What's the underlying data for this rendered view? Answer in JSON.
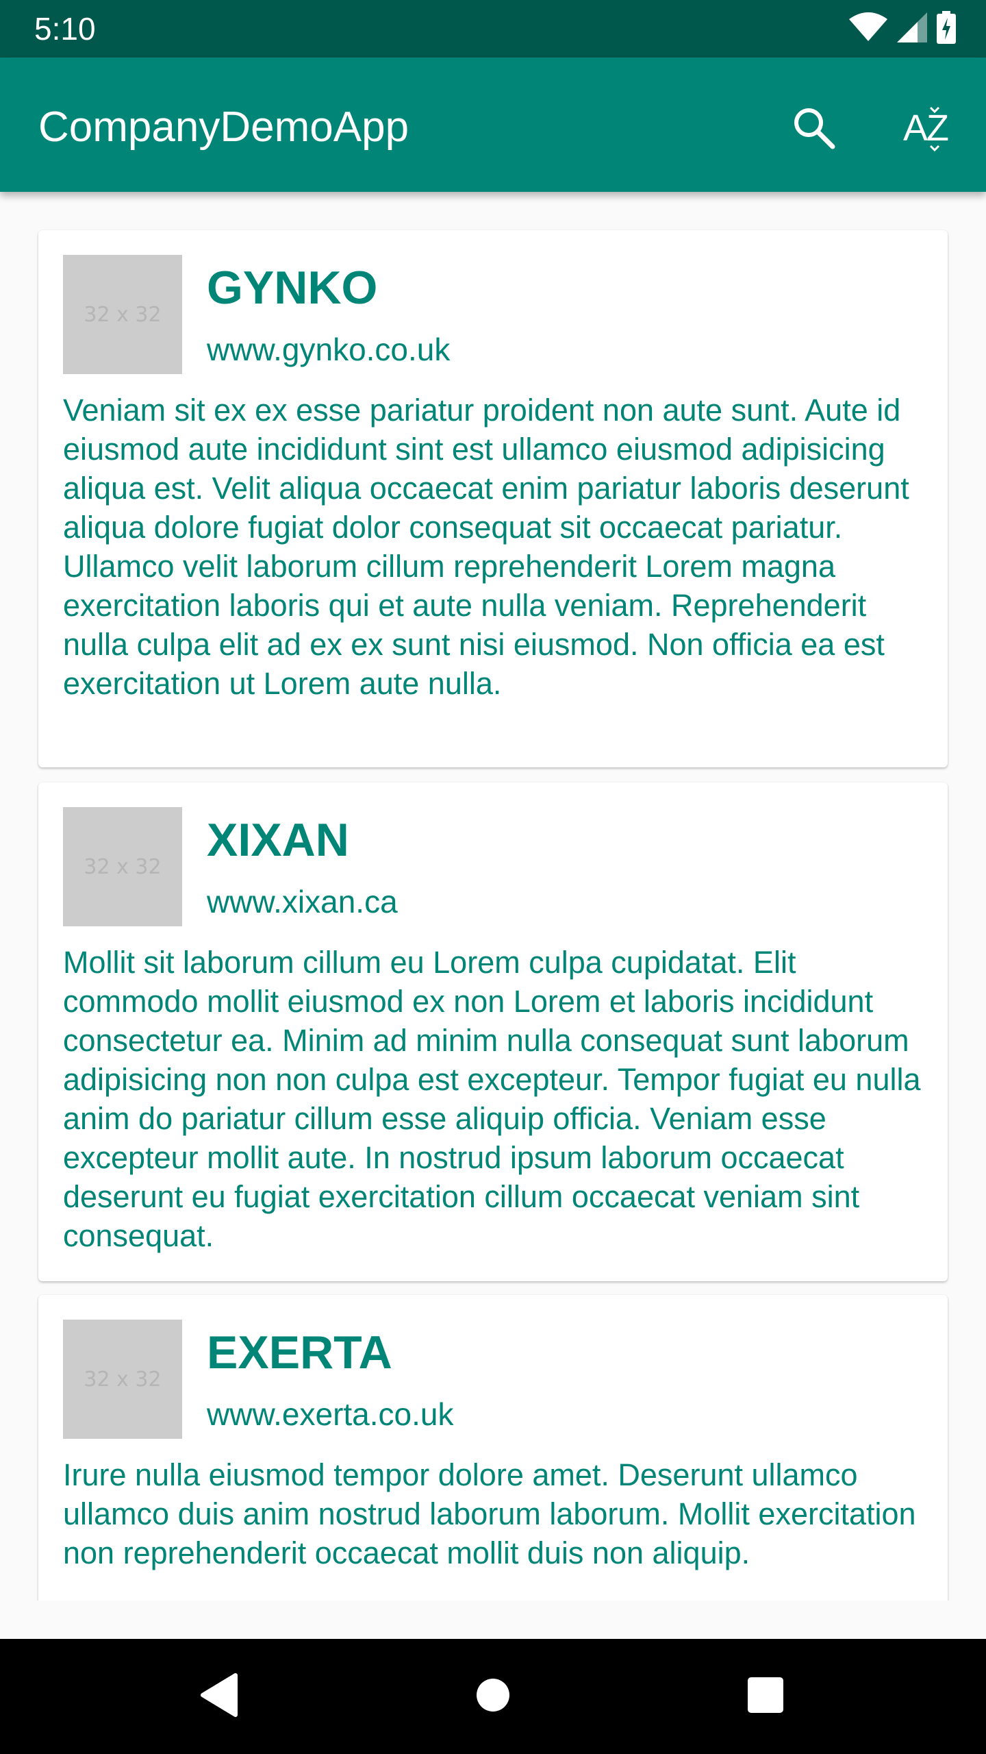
{
  "status_bar": {
    "time": "5:10"
  },
  "app_bar": {
    "title": "CompanyDemoApp",
    "sort_icon_text": "AZ"
  },
  "companies": [
    {
      "thumbnail_text": "32 x 32",
      "name": "GYNKO",
      "url": "www.gynko.co.uk",
      "description": "Veniam sit ex ex esse pariatur proident non aute sunt. Aute id eiusmod aute incididunt sint est ullamco eiusmod adipisicing aliqua est. Velit aliqua occaecat enim pariatur laboris deserunt aliqua dolore fugiat dolor consequat sit occaecat pariatur. Ullamco velit laborum cillum reprehenderit Lorem magna exercitation laboris qui et aute nulla veniam. Reprehenderit nulla culpa elit ad ex ex sunt nisi eiusmod. Non officia ea est exercitation ut Lorem aute nulla."
    },
    {
      "thumbnail_text": "32 x 32",
      "name": "XIXAN",
      "url": "www.xixan.ca",
      "description": "Mollit sit laborum cillum eu Lorem culpa cupidatat. Elit commodo mollit eiusmod ex non Lorem et laboris incididunt consectetur ea. Minim ad minim nulla consequat sunt laborum adipisicing non non culpa est excepteur. Tempor fugiat eu nulla anim do pariatur cillum esse aliquip officia. Veniam esse excepteur mollit aute. In nostrud ipsum laborum occaecat deserunt eu fugiat exercitation cillum occaecat veniam sint consequat."
    },
    {
      "thumbnail_text": "32 x 32",
      "name": "EXERTA",
      "url": "www.exerta.co.uk",
      "description": "Irure nulla eiusmod tempor dolore amet. Deserunt ullamco ullamco duis anim nostrud laborum laborum. Mollit exercitation non reprehenderit occaecat mollit duis non aliquip."
    }
  ],
  "colors": {
    "primary": "#008577",
    "primary_dark": "#00574b",
    "thumbnail": "#cccccc",
    "background": "#fafafa"
  }
}
